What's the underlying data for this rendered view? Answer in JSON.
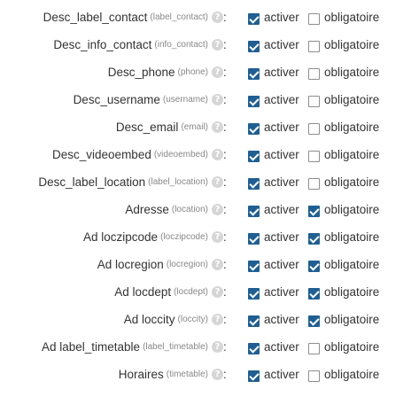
{
  "fields": [
    {
      "label": "Desc_label_contact",
      "key": "(label_contact)",
      "help_icon": "?",
      "colon": ":",
      "activer": {
        "label": "activer",
        "checked": true
      },
      "obligatoire": {
        "label": "obligatoire",
        "checked": false
      }
    },
    {
      "label": "Desc_info_contact",
      "key": "(info_contact)",
      "help_icon": "?",
      "colon": ":",
      "activer": {
        "label": "activer",
        "checked": true
      },
      "obligatoire": {
        "label": "obligatoire",
        "checked": false
      }
    },
    {
      "label": "Desc_phone",
      "key": "(phone)",
      "help_icon": "?",
      "colon": ":",
      "activer": {
        "label": "activer",
        "checked": true
      },
      "obligatoire": {
        "label": "obligatoire",
        "checked": false
      }
    },
    {
      "label": "Desc_username",
      "key": "(username)",
      "help_icon": "?",
      "colon": ":",
      "activer": {
        "label": "activer",
        "checked": true
      },
      "obligatoire": {
        "label": "obligatoire",
        "checked": false
      }
    },
    {
      "label": "Desc_email",
      "key": "(email)",
      "help_icon": "?",
      "colon": ":",
      "activer": {
        "label": "activer",
        "checked": true
      },
      "obligatoire": {
        "label": "obligatoire",
        "checked": false
      }
    },
    {
      "label": "Desc_videoembed",
      "key": "(videoembed)",
      "help_icon": "?",
      "colon": ":",
      "activer": {
        "label": "activer",
        "checked": true
      },
      "obligatoire": {
        "label": "obligatoire",
        "checked": false
      }
    },
    {
      "label": "Desc_label_location",
      "key": "(label_location)",
      "help_icon": "?",
      "colon": ":",
      "activer": {
        "label": "activer",
        "checked": true
      },
      "obligatoire": {
        "label": "obligatoire",
        "checked": false
      }
    },
    {
      "label": "Adresse",
      "key": "(location)",
      "help_icon": "?",
      "colon": ":",
      "activer": {
        "label": "activer",
        "checked": true
      },
      "obligatoire": {
        "label": "obligatoire",
        "checked": true
      }
    },
    {
      "label": "Ad loczipcode",
      "key": "(loczipcode)",
      "help_icon": "?",
      "colon": ":",
      "activer": {
        "label": "activer",
        "checked": true
      },
      "obligatoire": {
        "label": "obligatoire",
        "checked": true
      }
    },
    {
      "label": "Ad locregion",
      "key": "(locregion)",
      "help_icon": "?",
      "colon": ":",
      "activer": {
        "label": "activer",
        "checked": true
      },
      "obligatoire": {
        "label": "obligatoire",
        "checked": true
      }
    },
    {
      "label": "Ad locdept",
      "key": "(locdept)",
      "help_icon": "?",
      "colon": ":",
      "activer": {
        "label": "activer",
        "checked": true
      },
      "obligatoire": {
        "label": "obligatoire",
        "checked": true
      }
    },
    {
      "label": "Ad loccity",
      "key": "(loccity)",
      "help_icon": "?",
      "colon": ":",
      "activer": {
        "label": "activer",
        "checked": true
      },
      "obligatoire": {
        "label": "obligatoire",
        "checked": true
      }
    },
    {
      "label": "Ad label_timetable",
      "key": "(label_timetable)",
      "help_icon": "?",
      "colon": ":",
      "activer": {
        "label": "activer",
        "checked": true
      },
      "obligatoire": {
        "label": "obligatoire",
        "checked": false
      }
    },
    {
      "label": "Horaires",
      "key": "(timetable)",
      "help_icon": "?",
      "colon": ":",
      "activer": {
        "label": "activer",
        "checked": true
      },
      "obligatoire": {
        "label": "obligatoire",
        "checked": false
      }
    }
  ],
  "colors": {
    "checkbox_checked": "#1f5f93",
    "text": "#333333",
    "key_text": "#888888",
    "help_icon_bg": "#d6d6d6"
  }
}
